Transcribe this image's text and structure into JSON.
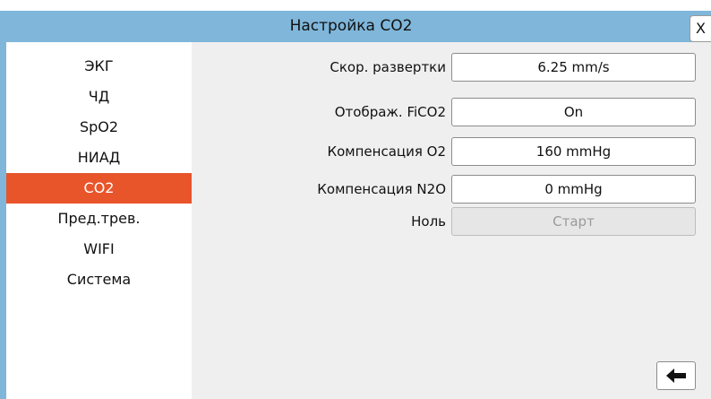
{
  "window": {
    "title": "Настройка CO2",
    "close_label": "X"
  },
  "sidebar": {
    "items": [
      {
        "label": "ЭКГ"
      },
      {
        "label": "ЧД"
      },
      {
        "label": "SpO2"
      },
      {
        "label": "НИАД"
      },
      {
        "label": "CO2",
        "active": true
      },
      {
        "label": "Пред.трев."
      },
      {
        "label": "WIFI"
      },
      {
        "label": "Система"
      }
    ]
  },
  "settings": {
    "rows": [
      {
        "label": "Скор. развертки",
        "value": "6.25 mm/s"
      },
      {
        "label": "Отображ. FiCO2",
        "value": "On"
      },
      {
        "label": "Компенсация O2",
        "value": "160 mmHg"
      },
      {
        "label": "Компенсация N2O",
        "value": "0 mmHg"
      },
      {
        "label": "Ноль",
        "value": "Старт",
        "disabled": true
      }
    ]
  },
  "footer": {
    "back_icon": "arrow-left-icon"
  },
  "colors": {
    "title_bar": "#7fb6da",
    "active_item": "#e8552b",
    "content_bg": "#efefef"
  }
}
